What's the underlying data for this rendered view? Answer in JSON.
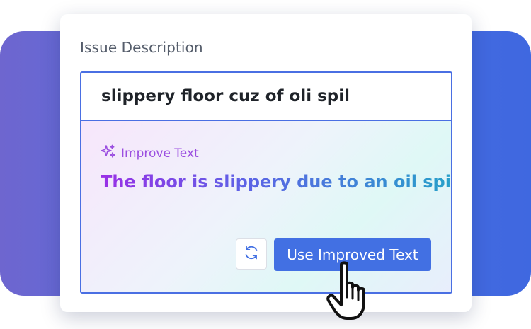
{
  "field": {
    "label": "Issue Description",
    "value": "slippery floor cuz of oli spil"
  },
  "suggestion": {
    "header_label": "Improve Text",
    "header_icon": "sparkle-icon",
    "text": "The floor is slippery due to an oil spill",
    "text_gradient": [
      "#9a30e6",
      "#5d62e6",
      "#24a3c8"
    ]
  },
  "actions": {
    "refresh_icon": "refresh-icon",
    "use_label": "Use Improved Text"
  },
  "colors": {
    "accent": "#4270e3",
    "border": "#4a6fe3",
    "improve_label": "#9b4ee0",
    "backdrop": "#4f6ee0"
  },
  "pointer": {
    "icon": "hand-pointer-icon"
  }
}
